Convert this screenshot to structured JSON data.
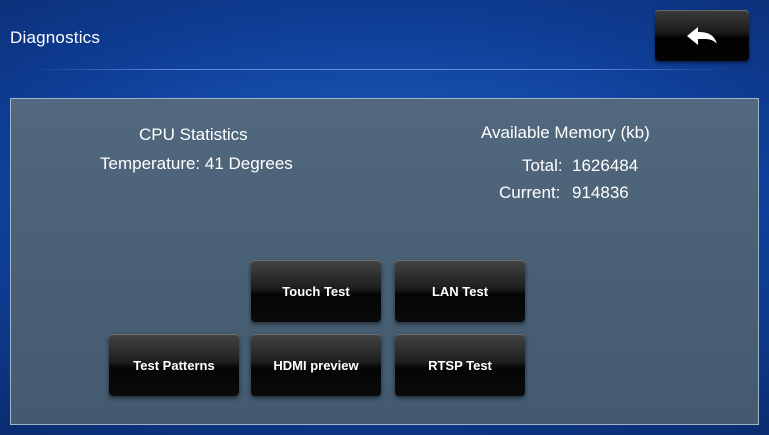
{
  "header": {
    "title": "Diagnostics",
    "back_icon": "back-arrow-icon"
  },
  "cpu": {
    "heading": "CPU Statistics",
    "temperature": "Temperature: 41 Degrees"
  },
  "memory": {
    "heading": "Available Memory (kb)",
    "total_label": "Total:",
    "total_value": "1626484",
    "current_label": "Current:",
    "current_value": "914836"
  },
  "buttons": {
    "touch_test": "Touch Test",
    "lan_test": "LAN Test",
    "test_patterns": "Test Patterns",
    "hdmi_preview": "HDMI preview",
    "rtsp_test": "RTSP Test"
  },
  "colors": {
    "background": "#1550b0",
    "panel": "#4d6378",
    "button": "#111111",
    "text": "#ffffff"
  }
}
